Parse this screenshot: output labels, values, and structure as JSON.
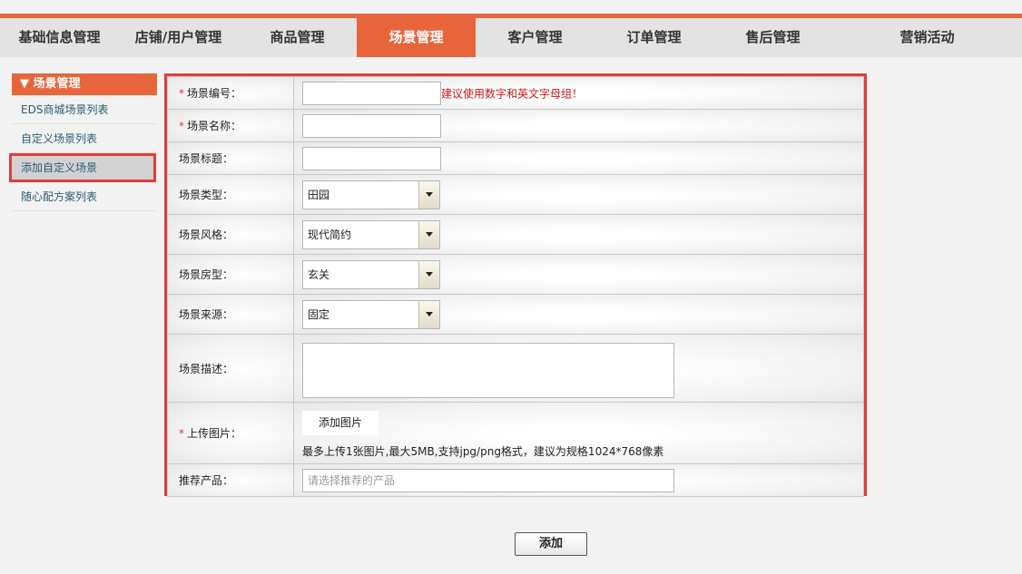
{
  "nav": {
    "items": [
      "基础信息管理",
      "店铺/用户管理",
      "商品管理",
      "场景管理",
      "客户管理",
      "订单管理",
      "售后管理",
      "营销活动"
    ],
    "active_index": 3
  },
  "sidebar": {
    "title": "▼ 场景管理",
    "items": [
      "EDS商城场景列表",
      "自定义场景列表",
      "添加自定义场景",
      "随心配方案列表"
    ],
    "active_index": 2
  },
  "form": {
    "required_mark": "*",
    "scene_code": {
      "label": "场景编号：",
      "value": "",
      "hint": "建议使用数字和英文字母组！"
    },
    "scene_name": {
      "label": "场景名称：",
      "value": ""
    },
    "scene_title": {
      "label": "场景标题：",
      "value": ""
    },
    "scene_type": {
      "label": "场景类型：",
      "selected": "田园"
    },
    "scene_style": {
      "label": "场景风格：",
      "selected": "现代简约"
    },
    "scene_room": {
      "label": "场景房型：",
      "selected": "玄关"
    },
    "scene_source": {
      "label": "场景来源：",
      "selected": "固定"
    },
    "scene_desc": {
      "label": "场景描述：",
      "value": ""
    },
    "upload": {
      "label": "上传图片：",
      "button": "添加图片",
      "note": "最多上传1张图片,最大5MB,支持jpg/png格式，建议为规格1024*768像素"
    },
    "recommend": {
      "label": "推荐产品：",
      "placeholder": "请选择推荐的产品"
    }
  },
  "submit_label": "添加",
  "colors": {
    "accent": "#e8653c",
    "highlight_border": "#e23d3d",
    "hint": "#c91818"
  }
}
